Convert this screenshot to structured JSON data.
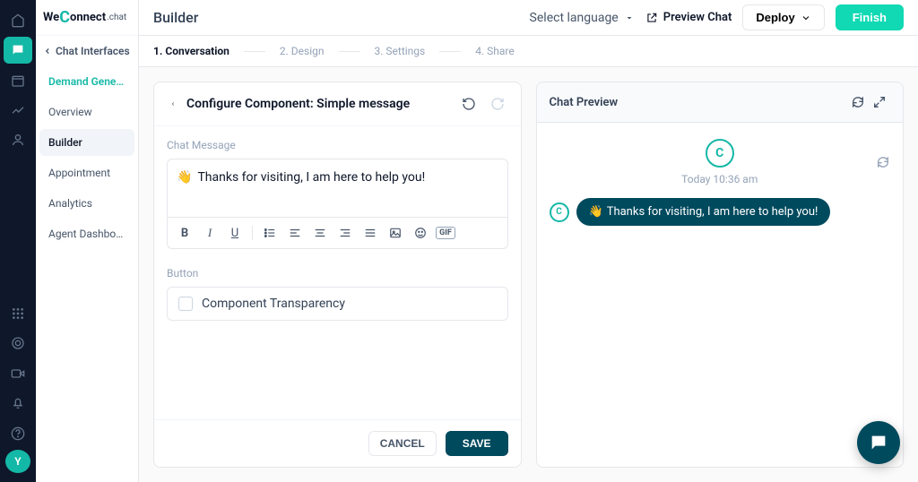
{
  "logo": {
    "pre": "We",
    "c": "C",
    "post": "onnect",
    "tag": ".chat"
  },
  "page_title": "Builder",
  "header": {
    "language": "Select language",
    "preview": "Preview Chat",
    "deploy": "Deploy",
    "finish": "Finish"
  },
  "sidebar": {
    "head": "Chat Interfaces",
    "items": [
      "Demand Generati...",
      "Overview",
      "Builder",
      "Appointment",
      "Analytics",
      "Agent Dashboard"
    ]
  },
  "steps": [
    "1. Conversation",
    "2. Design",
    "3. Settings",
    "4. Share"
  ],
  "config": {
    "title": "Configure Component: Simple message",
    "chat_message_label": "Chat Message",
    "emoji": "👋",
    "message": "Thanks for visiting, I am here to help you!",
    "button_label": "Button",
    "transparency_label": "Component Transparency",
    "cancel": "CANCEL",
    "save": "SAVE"
  },
  "preview": {
    "title": "Chat Preview",
    "timestamp": "Today 10:36 am",
    "emoji": "👋",
    "message": "Thanks for visiting, I am here to help you!"
  },
  "avatar_initial": "Y"
}
